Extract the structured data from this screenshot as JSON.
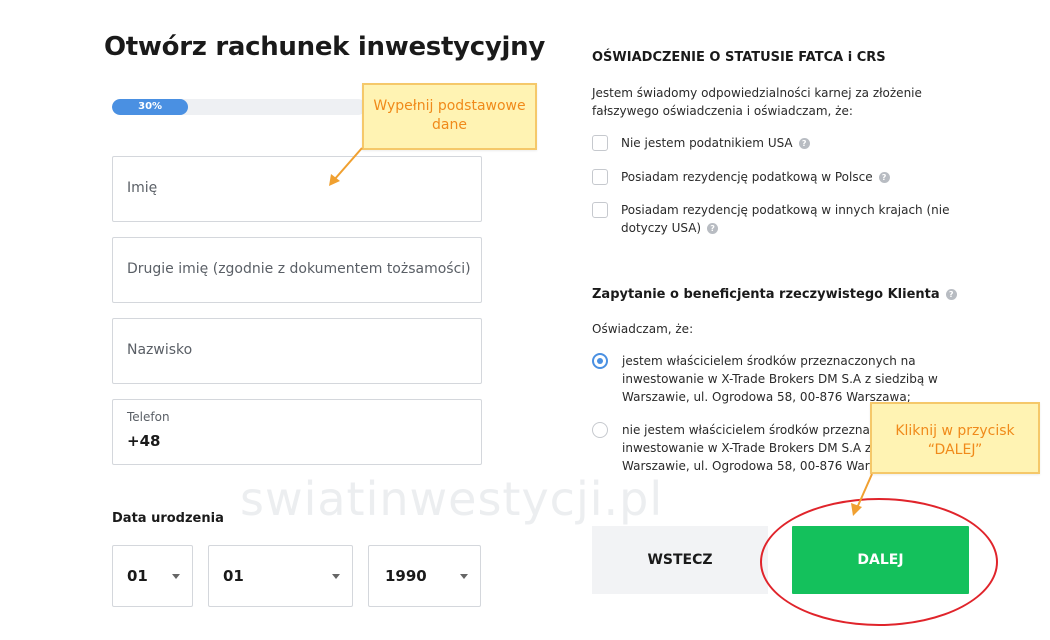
{
  "page": {
    "title": "Otwórz rachunek inwestycyjny",
    "watermark": "swiatinwestycji.pl"
  },
  "progress": {
    "label": "30%",
    "value": 0.3
  },
  "form": {
    "first_name_placeholder": "Imię",
    "middle_name_placeholder": "Drugie imię (zgodnie z dokumentem tożsamości)",
    "last_name_placeholder": "Nazwisko",
    "phone_label": "Telefon",
    "phone_value": "+48",
    "dob_label": "Data urodzenia",
    "dob_day": "01",
    "dob_month": "01",
    "dob_year": "1990"
  },
  "fatca": {
    "heading": "OŚWIADCZENIE O STATUSIE FATCA i CRS",
    "intro": "Jestem świadomy odpowiedzialności karnej za złożenie fałszywego oświadczenia i oświadczam, że:",
    "options": [
      {
        "label": "Nie jestem podatnikiem USA",
        "checked": false
      },
      {
        "label": "Posiadam rezydencję podatkową w Polsce",
        "checked": false
      },
      {
        "label": "Posiadam rezydencję podatkową w innych krajach (nie dotyczy USA)",
        "checked": false
      }
    ]
  },
  "beneficiary": {
    "heading": "Zapytanie o beneficjenta rzeczywistego Klienta",
    "intro": "Oświadczam, że:",
    "options": [
      {
        "label": "jestem właścicielem środków przeznaczonych na inwestowanie w X-Trade Brokers DM S.A z siedzibą w Warszawie, ul. Ogrodowa 58, 00-876 Warszawa;",
        "selected": true
      },
      {
        "label": "nie jestem właścicielem środków przeznaczonych na inwestowanie w X-Trade Brokers DM S.A z siedzibą w Warszawie, ul. Ogrodowa 58, 00-876 Warszawa",
        "selected": false
      }
    ]
  },
  "buttons": {
    "back": "WSTECZ",
    "next": "DALEJ"
  },
  "annotations": {
    "note1": "Wypełnij podstawowe dane",
    "note2": "Kliknij w przycisk “DALEJ”"
  },
  "colors": {
    "accent": "#4a90e2",
    "next_button": "#14c15c",
    "note_bg": "#fff3b3",
    "note_text": "#f08a1a",
    "highlight_ring": "#e0242b"
  }
}
